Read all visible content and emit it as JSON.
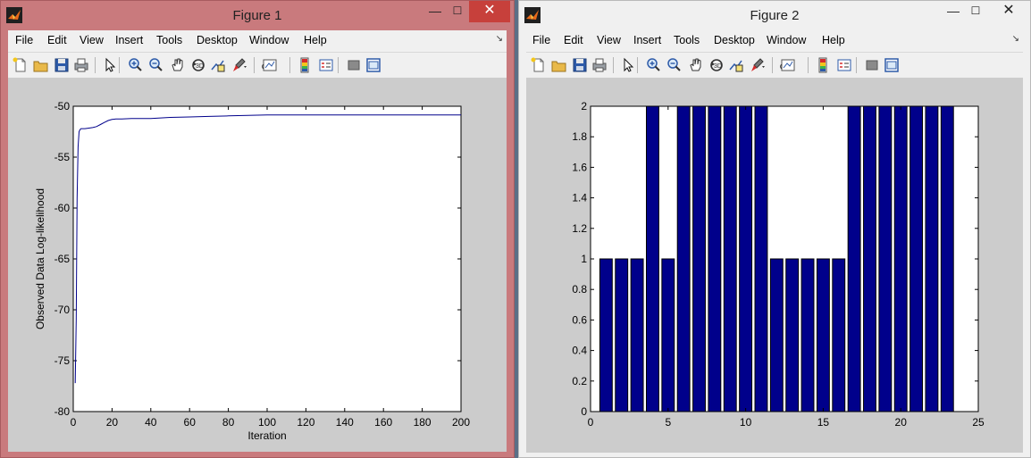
{
  "figure1": {
    "title": "Figure 1",
    "menu": [
      "File",
      "Edit",
      "View",
      "Insert",
      "Tools",
      "Desktop",
      "Window",
      "Help"
    ],
    "controls": {
      "minimize": "—",
      "maximize": "☐",
      "close": "✕"
    }
  },
  "figure2": {
    "title": "Figure 2",
    "menu": [
      "File",
      "Edit",
      "View",
      "Insert",
      "Tools",
      "Desktop",
      "Window",
      "Help"
    ],
    "controls": {
      "minimize": "—",
      "maximize": "☐",
      "close": "✕"
    }
  },
  "toolbar_icons": [
    "new-figure-icon",
    "open-file-icon",
    "save-icon",
    "print-icon",
    "edit-plot-arrow-icon",
    "zoom-in-icon",
    "zoom-out-icon",
    "pan-hand-icon",
    "rotate-3d-icon",
    "data-cursor-icon",
    "brush-icon",
    "link-plot-icon",
    "insert-colorbar-icon",
    "insert-legend-icon",
    "hide-plot-tools-icon",
    "show-plot-tools-icon"
  ],
  "colors": {
    "line": "#00008b",
    "bar_fill": "#00008b",
    "bar_edge": "#000000",
    "plot_bg": "#ffffff",
    "figure_bg": "#cccccc"
  },
  "chart_data": [
    {
      "type": "line",
      "xlabel": "Iteration",
      "ylabel": "Observed Data Log-likelihood",
      "xlim": [
        0,
        200
      ],
      "ylim": [
        -80,
        -50
      ],
      "xticks": [
        0,
        20,
        40,
        60,
        80,
        100,
        120,
        140,
        160,
        180,
        200
      ],
      "yticks": [
        -80,
        -75,
        -70,
        -65,
        -60,
        -55,
        -50
      ],
      "grid": false,
      "series": [
        {
          "x": [
            1,
            1.5,
            2,
            2.5,
            3,
            3.5,
            4,
            6,
            8,
            10,
            12,
            14,
            16,
            18,
            20,
            22,
            25,
            30,
            40,
            50,
            60,
            70,
            80,
            90,
            100,
            120,
            140,
            160,
            180,
            200
          ],
          "y": [
            -77.2,
            -71,
            -59,
            -54,
            -52.5,
            -52.3,
            -52.2,
            -52.2,
            -52.15,
            -52.1,
            -52.0,
            -51.8,
            -51.6,
            -51.4,
            -51.3,
            -51.25,
            -51.25,
            -51.2,
            -51.2,
            -51.1,
            -51.05,
            -51.0,
            -50.95,
            -50.9,
            -50.85,
            -50.85,
            -50.85,
            -50.85,
            -50.85,
            -50.85
          ]
        }
      ]
    },
    {
      "type": "bar",
      "xlim": [
        0,
        25
      ],
      "ylim": [
        0,
        2
      ],
      "xticks": [
        0,
        5,
        10,
        15,
        20,
        25
      ],
      "yticks": [
        0,
        0.2,
        0.4,
        0.6,
        0.8,
        1,
        1.2,
        1.4,
        1.6,
        1.8,
        2
      ],
      "grid": false,
      "categories": [
        1,
        2,
        3,
        4,
        5,
        6,
        7,
        8,
        9,
        10,
        11,
        12,
        13,
        14,
        15,
        16,
        17,
        18,
        19,
        20,
        21,
        22,
        23
      ],
      "values": [
        1,
        1,
        1,
        2,
        1,
        2,
        2,
        2,
        2,
        2,
        2,
        1,
        1,
        1,
        1,
        1,
        2,
        2,
        2,
        2,
        2,
        2,
        2
      ]
    }
  ]
}
